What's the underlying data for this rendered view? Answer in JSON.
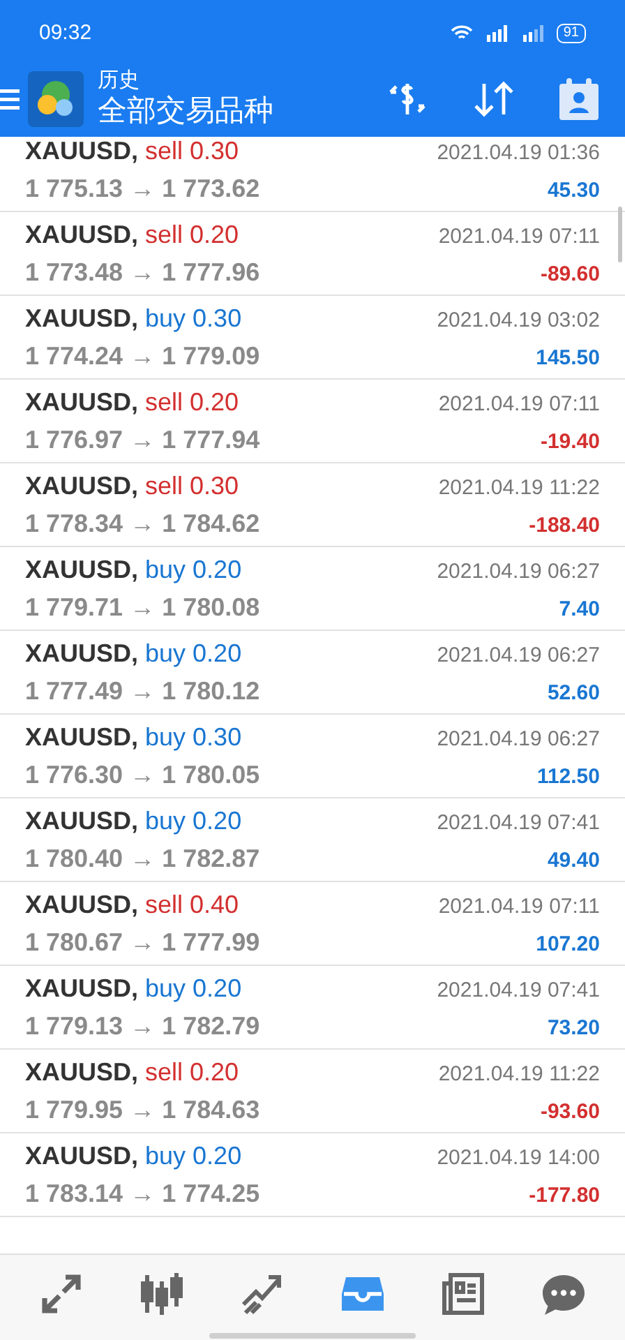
{
  "status_bar": {
    "time": "09:32",
    "battery": "91"
  },
  "header": {
    "subtitle": "历史",
    "title": "全部交易品种"
  },
  "trades": [
    {
      "symbol": "XAUUSD,",
      "type": "sell",
      "volume": "0.30",
      "prices": "1 775.13 → 1 773.62",
      "time": "2021.04.19 01:36",
      "profit": "45.30",
      "loss": false
    },
    {
      "symbol": "XAUUSD,",
      "type": "sell",
      "volume": "0.20",
      "prices": "1 773.48 → 1 777.96",
      "time": "2021.04.19 07:11",
      "profit": "-89.60",
      "loss": true
    },
    {
      "symbol": "XAUUSD,",
      "type": "buy",
      "volume": "0.30",
      "prices": "1 774.24 → 1 779.09",
      "time": "2021.04.19 03:02",
      "profit": "145.50",
      "loss": false
    },
    {
      "symbol": "XAUUSD,",
      "type": "sell",
      "volume": "0.20",
      "prices": "1 776.97 → 1 777.94",
      "time": "2021.04.19 07:11",
      "profit": "-19.40",
      "loss": true
    },
    {
      "symbol": "XAUUSD,",
      "type": "sell",
      "volume": "0.30",
      "prices": "1 778.34 → 1 784.62",
      "time": "2021.04.19 11:22",
      "profit": "-188.40",
      "loss": true
    },
    {
      "symbol": "XAUUSD,",
      "type": "buy",
      "volume": "0.20",
      "prices": "1 779.71 → 1 780.08",
      "time": "2021.04.19 06:27",
      "profit": "7.40",
      "loss": false
    },
    {
      "symbol": "XAUUSD,",
      "type": "buy",
      "volume": "0.20",
      "prices": "1 777.49 → 1 780.12",
      "time": "2021.04.19 06:27",
      "profit": "52.60",
      "loss": false
    },
    {
      "symbol": "XAUUSD,",
      "type": "buy",
      "volume": "0.30",
      "prices": "1 776.30 → 1 780.05",
      "time": "2021.04.19 06:27",
      "profit": "112.50",
      "loss": false
    },
    {
      "symbol": "XAUUSD,",
      "type": "buy",
      "volume": "0.20",
      "prices": "1 780.40 → 1 782.87",
      "time": "2021.04.19 07:41",
      "profit": "49.40",
      "loss": false
    },
    {
      "symbol": "XAUUSD,",
      "type": "sell",
      "volume": "0.40",
      "prices": "1 780.67 → 1 777.99",
      "time": "2021.04.19 07:11",
      "profit": "107.20",
      "loss": false
    },
    {
      "symbol": "XAUUSD,",
      "type": "buy",
      "volume": "0.20",
      "prices": "1 779.13 → 1 782.79",
      "time": "2021.04.19 07:41",
      "profit": "73.20",
      "loss": false
    },
    {
      "symbol": "XAUUSD,",
      "type": "sell",
      "volume": "0.20",
      "prices": "1 779.95 → 1 784.63",
      "time": "2021.04.19 11:22",
      "profit": "-93.60",
      "loss": true
    },
    {
      "symbol": "XAUUSD,",
      "type": "buy",
      "volume": "0.20",
      "prices": "1 783.14 → 1 774.25",
      "time": "2021.04.19 14:00",
      "profit": "-177.80",
      "loss": true
    }
  ],
  "nav": [
    {
      "kind": "quotes",
      "selected": false
    },
    {
      "kind": "chart",
      "selected": false
    },
    {
      "kind": "trade",
      "selected": false
    },
    {
      "kind": "history",
      "selected": true
    },
    {
      "kind": "news",
      "selected": false
    },
    {
      "kind": "chat",
      "selected": false
    }
  ]
}
